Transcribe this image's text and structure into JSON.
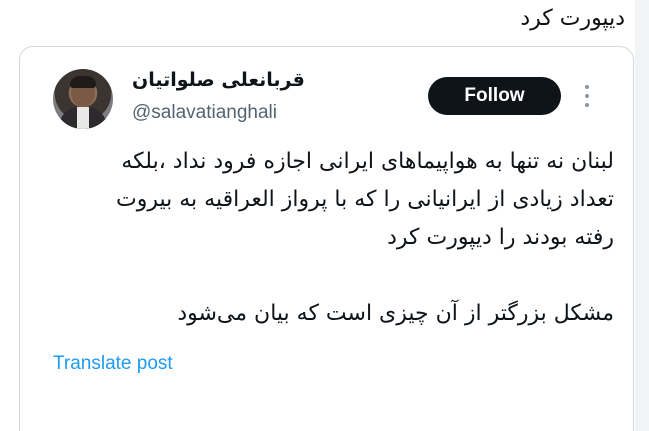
{
  "caption": "دیپورت کرد",
  "tweet": {
    "author": {
      "display_name": "قربانعلی صلواتیان",
      "handle": "@salavatianghali"
    },
    "follow_label": "Follow",
    "text": "لبنان نه تنها به هواپیماهای ایرانی اجازه فرود نداد ،بلکه\nتعداد زیادی از ایرانیانی را که با پرواز العراقیه به بیروت\nرفته بودند را دیپورت کرد\n\nمشکل بزرگتر از آن چیزی است که بیان می‌شود",
    "translate_label": "Translate post"
  },
  "colors": {
    "follow_bg": "#0f1419",
    "link": "#1d9bf0",
    "secondary_text": "#536471"
  },
  "icons": {
    "more": "more-vertical-icon",
    "avatar": "profile-photo"
  }
}
